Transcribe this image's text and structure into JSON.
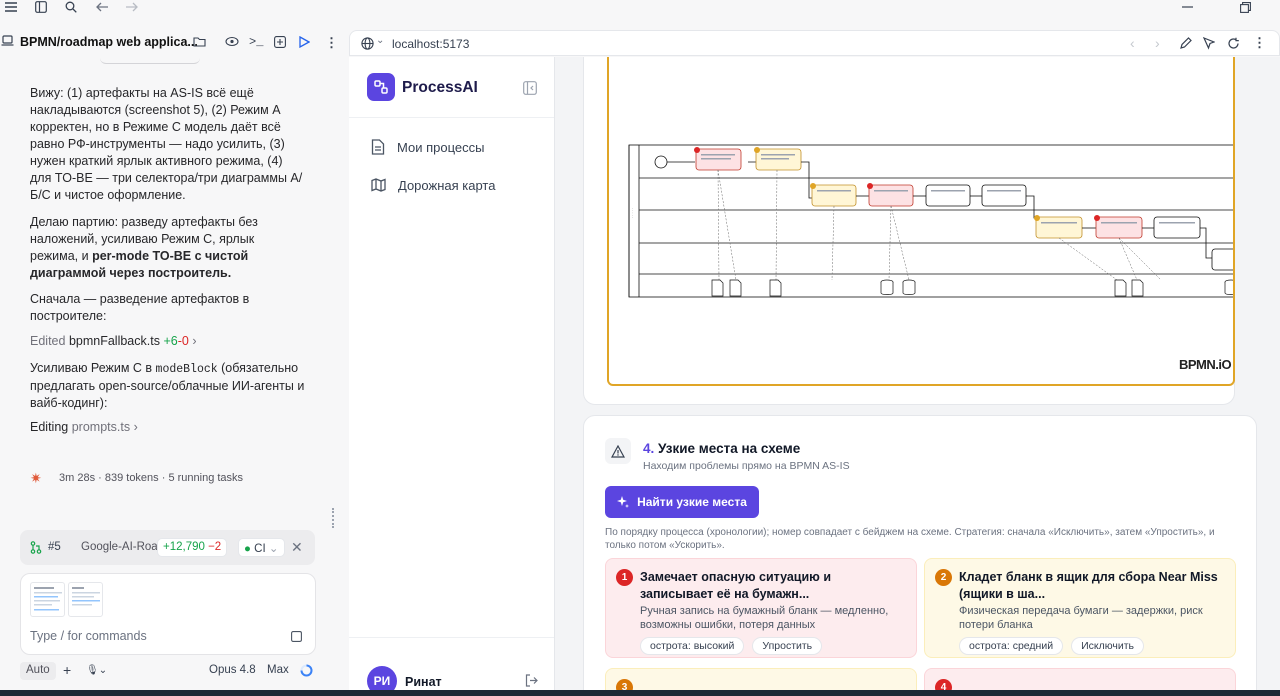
{
  "topbar": {
    "icons": [
      "menu-icon",
      "sidebar-icon",
      "search-icon",
      "back-arrow-icon",
      "forward-arrow-icon",
      "restore-window-icon"
    ]
  },
  "left": {
    "title": "BPMN/roadmap web applica...",
    "para1": "Вижу: (1) артефакты на AS-IS всё ещё накладываются (screenshot 5), (2) Режим A корректен, но в Режиме C модель даёт всё равно РФ-инструменты — надо усилить, (3) нужен краткий ярлык активного режима, (4) для TO-BE — три селектора/три диаграммы А/Б/С и чистое оформление.",
    "para2_a": "Делаю партию: разведу артефакты без наложений, усиливаю Режим C, ярлык режима, и ",
    "para2_b": "per-mode TO-BE с чистой диаграммой через построитель.",
    "para3": "Сначала — разведение артефактов в построителе:",
    "edited_label": "Edited",
    "edited_file": "bpmnFallback.ts",
    "edited_plus": "+6",
    "edited_minus": "-0",
    "para4_a": "Усиливаю Режим C в ",
    "para4_code": "modeBlock",
    "para4_b": " (обязательно предлагать open-source/облачные ИИ-агенты и вайб-кодинг):",
    "editing_label": "Editing",
    "editing_file": "prompts.ts",
    "status": "3m 28s · 839 tokens · 5 running tasks",
    "pr_num": "#5",
    "pr_branch": "Google-AI-Roa",
    "pr_plus": "+12,790",
    "pr_minus": "−2",
    "pr_ci": "CI",
    "input_placeholder": "Type / for commands",
    "mode_label": "Auto",
    "model_label": "Opus 4.8",
    "effort_label": "Max"
  },
  "browser": {
    "url": "localhost:5173"
  },
  "app": {
    "logo_text": "ProcessAI",
    "nav": [
      {
        "label": "Мои процессы"
      },
      {
        "label": "Дорожная карта"
      }
    ],
    "user_initials": "РИ",
    "user_name": "Ринат",
    "bpmn_watermark": "BPMN.iO",
    "section_num": "4.",
    "section_title": "Узкие места на схеме",
    "section_subtitle": "Находим проблемы прямо на BPMN AS-IS",
    "find_button": "Найти узкие места",
    "hint": "По порядку процесса (хронологии); номер совпадает с бейджем на схеме. Стратегия: сначала «Исключить», затем «Упростить», и только потом «Ускорить».",
    "bottlenecks": [
      {
        "num": "1",
        "title": "Замечает опасную ситуацию и записывает её на бумажн...",
        "desc": "Ручная запись на бумажный бланк — медленно, возможны ошибки, потеря данных",
        "severity": "острота: высокий",
        "action": "Упростить",
        "bg": "#fdecee",
        "border": "#fbd5d9",
        "badge": "#dc2626"
      },
      {
        "num": "2",
        "title": "Кладет бланк в ящик для сбора Near Miss (ящики в ша...",
        "desc": "Физическая передача бумаги — задержки, риск потери бланка",
        "severity": "острота: средний",
        "action": "Исключить",
        "bg": "#fef9e6",
        "border": "#fbeebb",
        "badge": "#d97706"
      },
      {
        "num": "3",
        "title": "",
        "desc": "",
        "severity": "",
        "action": "",
        "bg": "#fef9e6",
        "border": "#fbeebb",
        "badge": "#d97706"
      },
      {
        "num": "4",
        "title": "",
        "desc": "",
        "severity": "",
        "action": "",
        "bg": "#fdecee",
        "border": "#fbd5d9",
        "badge": "#dc2626"
      }
    ]
  },
  "colors": {
    "accent": "#5b45e0",
    "diff_plus": "#16a34a",
    "diff_minus": "#dc2626",
    "bpmn_frame": "#e0a526"
  }
}
